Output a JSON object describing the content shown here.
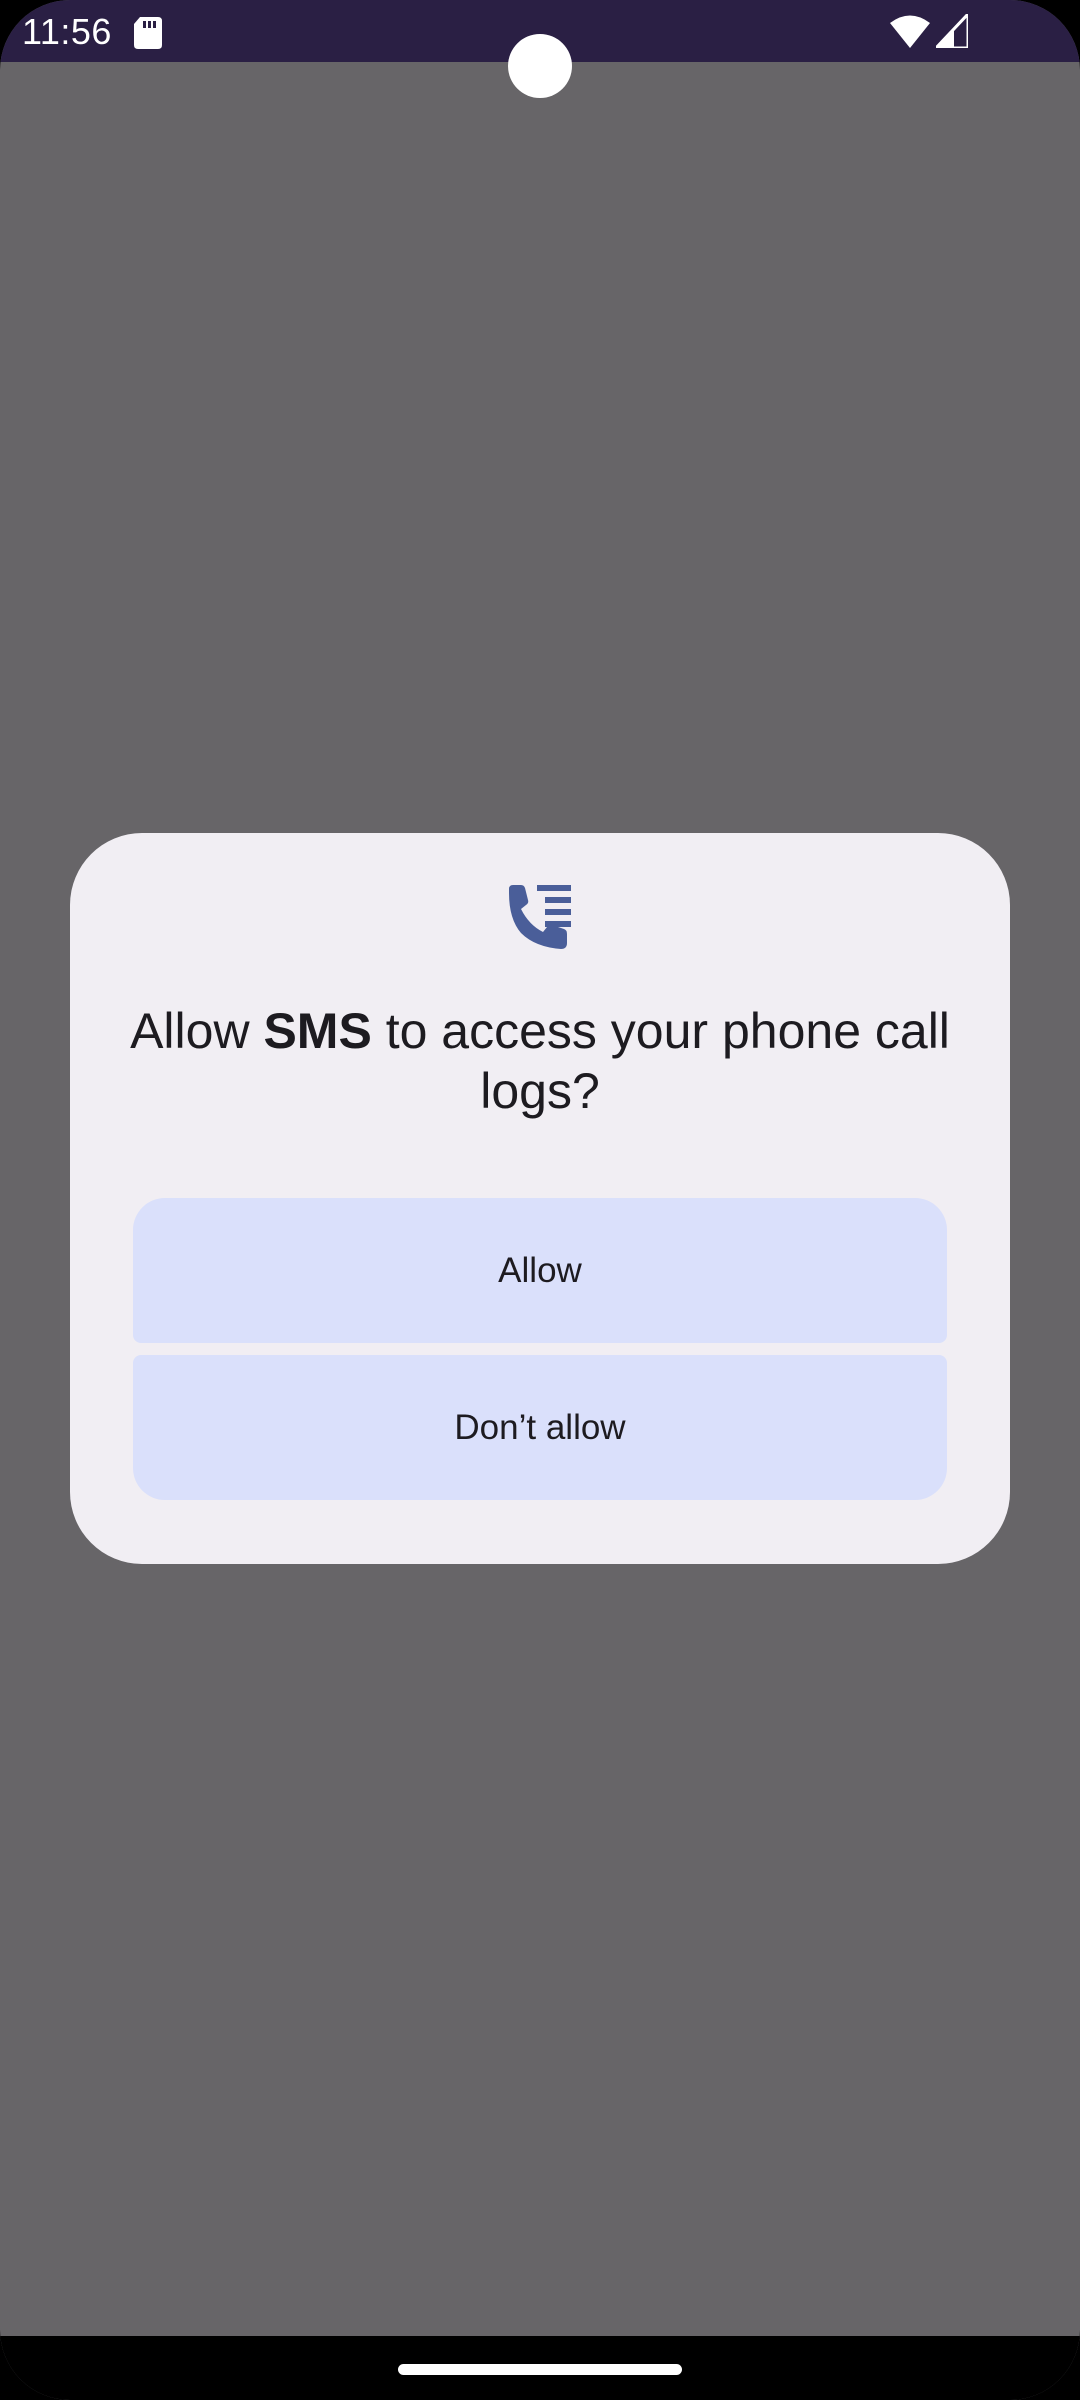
{
  "status_bar": {
    "time": "11:56",
    "icons": [
      "sd-card-icon",
      "wifi-icon",
      "cell-signal-icon"
    ]
  },
  "dialog": {
    "icon": "call-log-icon",
    "title_prefix": "Allow ",
    "app_name": "SMS",
    "title_suffix": " to access your phone call logs?",
    "allow_label": "Allow",
    "deny_label": "Don’t allow"
  },
  "colors": {
    "scrim": "#676568",
    "status_bar": "#2a1f44",
    "dialog_bg": "#f1eef3",
    "button_bg": "#dae0fb",
    "icon_accent": "#4a5e99",
    "text": "#1d1b20"
  }
}
